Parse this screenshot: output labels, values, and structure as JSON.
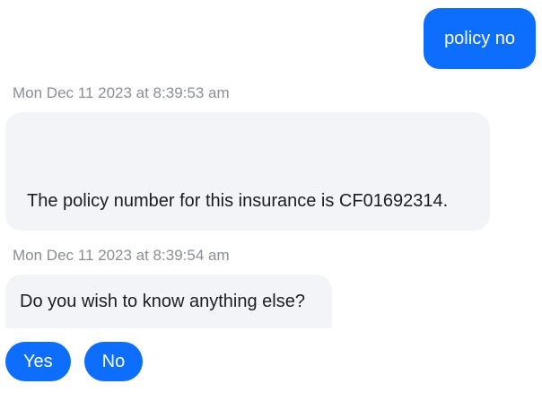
{
  "colors": {
    "accent": "#0d6efd",
    "bot_bubble": "#f3f4f7",
    "timestamp": "#8b8e95",
    "text": "#1c1d1f"
  },
  "messages": [
    {
      "sender": "user",
      "text": "policy no"
    },
    {
      "sender": "bot",
      "timestamp": "Mon Dec 11 2023 at 8:39:53 am",
      "text": "The policy number for this insurance is CF01692314."
    },
    {
      "sender": "bot",
      "timestamp": "Mon Dec 11 2023 at 8:39:54 am",
      "text": "Do you wish to know anything else?"
    }
  ],
  "quick_replies": [
    {
      "label": "Yes"
    },
    {
      "label": "No"
    }
  ]
}
